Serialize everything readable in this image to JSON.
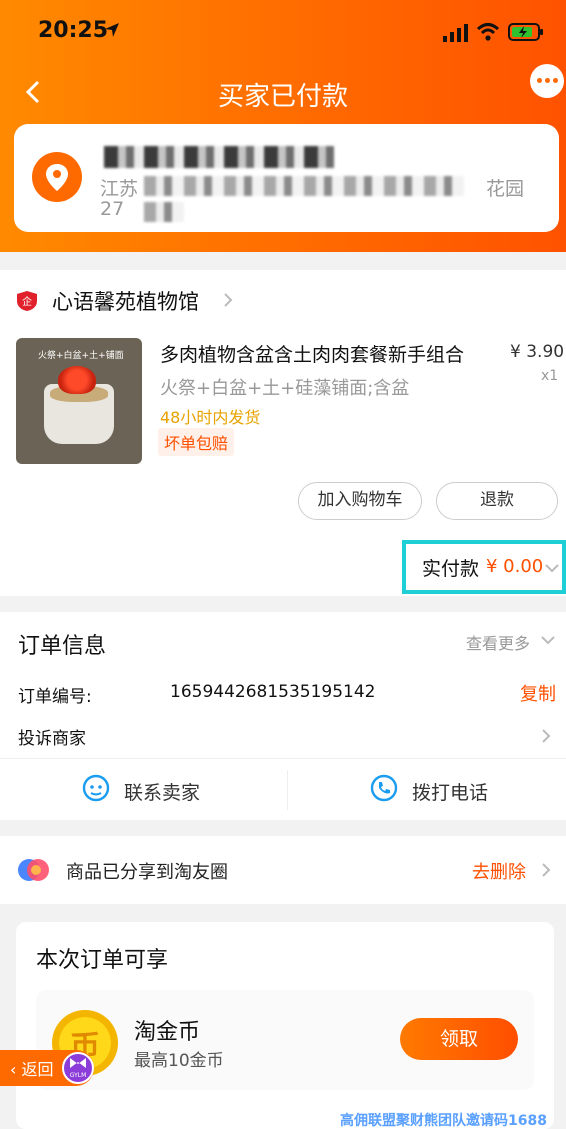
{
  "status_bar": {
    "time": "20:25"
  },
  "nav": {
    "title": "买家已付款"
  },
  "address": {
    "line1_end": "花园",
    "line1_start": "江苏",
    "line2": "27"
  },
  "shop": {
    "name": "心语馨苑植物馆"
  },
  "product": {
    "title": "多肉植物含盆含土肉肉套餐新手组合",
    "price": "¥ 3.90",
    "qty": "x1",
    "sku": "火祭+白盆+土+硅藻铺面;含盆",
    "shipping": "48小时内发货",
    "guarantee": "坏单包赔",
    "thumb_label": "火祭+白盆+土+铺面"
  },
  "buttons": {
    "add_cart": "加入购物车",
    "refund": "退款"
  },
  "paid": {
    "label": "实付款",
    "value": "¥ 0.00"
  },
  "order_info": {
    "title": "订单信息",
    "see_more": "查看更多",
    "order_no_label": "订单编号:",
    "order_no": "1659442681535195142",
    "copy": "复制",
    "complaint": "投诉商家"
  },
  "actions": {
    "contact": "联系卖家",
    "call": "拨打电话"
  },
  "share": {
    "text": "商品已分享到淘友圈",
    "delete": "去删除"
  },
  "perks": {
    "title": "本次订单可享",
    "coin_name": "淘金币",
    "coin_desc": "最高10金币",
    "coin_glyph": "币",
    "get_button": "领取"
  },
  "floating": {
    "return": "返回",
    "badge": "GYLM"
  },
  "watermark": "高佣联盟聚财熊团队邀请码1688",
  "colors": {
    "accent": "#ff6a00",
    "highlight_border": "#1ed0d6",
    "link_orange": "#ff5000"
  }
}
